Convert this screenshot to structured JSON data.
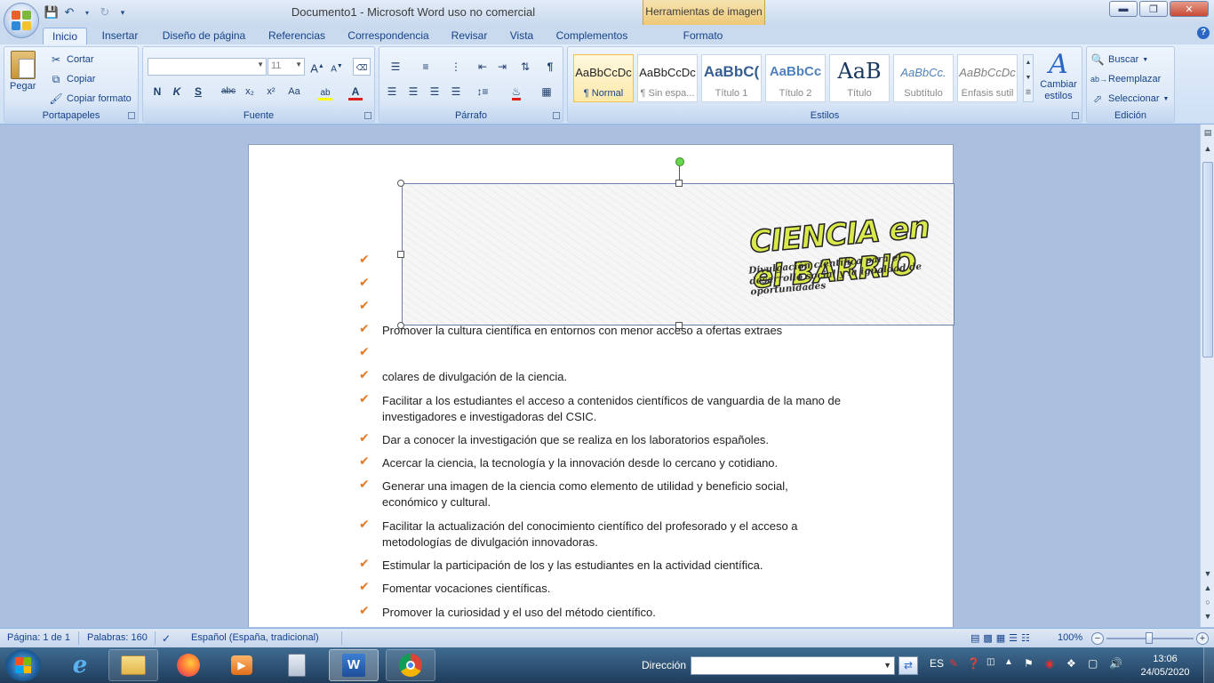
{
  "window": {
    "title": "Documento1 - Microsoft Word uso no comercial",
    "contextual_tab": "Herramientas de imagen"
  },
  "tabs": [
    {
      "label": "Inicio",
      "active": true
    },
    {
      "label": "Insertar"
    },
    {
      "label": "Diseño de página"
    },
    {
      "label": "Referencias"
    },
    {
      "label": "Correspondencia"
    },
    {
      "label": "Revisar"
    },
    {
      "label": "Vista"
    },
    {
      "label": "Complementos"
    },
    {
      "label": "Formato"
    }
  ],
  "ribbon": {
    "clipboard": {
      "label": "Portapapeles",
      "paste": "Pegar",
      "cut": "Cortar",
      "copy": "Copiar",
      "format_painter": "Copiar formato"
    },
    "font": {
      "label": "Fuente",
      "font_name": "",
      "font_size": "11",
      "bold": "N",
      "italic": "K",
      "underline": "S",
      "strike": "abc",
      "subscript": "x₂",
      "superscript": "x²",
      "change_case": "Aa",
      "grow": "A",
      "shrink": "A"
    },
    "paragraph": {
      "label": "Párrafo"
    },
    "styles": {
      "label": "Estilos",
      "items": [
        {
          "sample": "AaBbCcDc",
          "name": "¶ Normal",
          "selected": true
        },
        {
          "sample": "AaBbCcDc",
          "name": "¶ Sin espa..."
        },
        {
          "sample": "AaBbC(",
          "name": "Título 1"
        },
        {
          "sample": "AaBbCc",
          "name": "Título 2"
        },
        {
          "sample": "AaB",
          "name": "Título"
        },
        {
          "sample": "AaBbCc.",
          "name": "Subtítulo"
        },
        {
          "sample": "AaBbCcDc",
          "name": "Énfasis sutil"
        }
      ],
      "change_styles": "Cambiar estilos"
    },
    "editing": {
      "label": "Edición",
      "find": "Buscar",
      "replace": "Reemplazar",
      "select": "Seleccionar"
    }
  },
  "document": {
    "banner": {
      "title": "CIENCIA en el BARRIO",
      "subtitle": "Divulgación científica para el desarrollo social y la igualdad de oportunidades"
    },
    "lines": [
      "",
      "",
      "",
      "Promover la cultura científica en entornos con menor acceso a ofertas extraes",
      "",
      "colares de divulgación de la ciencia.",
      "Facilitar a los estudiantes el acceso a contenidos científicos de vanguardia de la mano de investigadores e investigadoras del CSIC.",
      "Dar a conocer la investigación que se realiza en los laboratorios españoles.",
      "Acercar la ciencia, la tecnología y la innovación desde lo cercano y cotidiano.",
      "Generar una imagen de la ciencia como elemento de utilidad y beneficio social, económico y cultural.",
      "Facilitar la actualización del conocimiento científico del profesorado y el acceso a metodologías de divulgación innovadoras.",
      "Estimular la participación de los y las estudiantes en la actividad científica.",
      "Fomentar vocaciones científicas.",
      "Promover la curiosidad y el uso del método científico."
    ]
  },
  "status": {
    "page": "Página: 1 de 1",
    "words": "Palabras: 160",
    "language": "Español (España, tradicional)",
    "zoom": "100%"
  },
  "taskbar": {
    "address_label": "Dirección",
    "address_value": "",
    "lang": "ES",
    "time": "13:06",
    "date": "24/05/2020"
  }
}
